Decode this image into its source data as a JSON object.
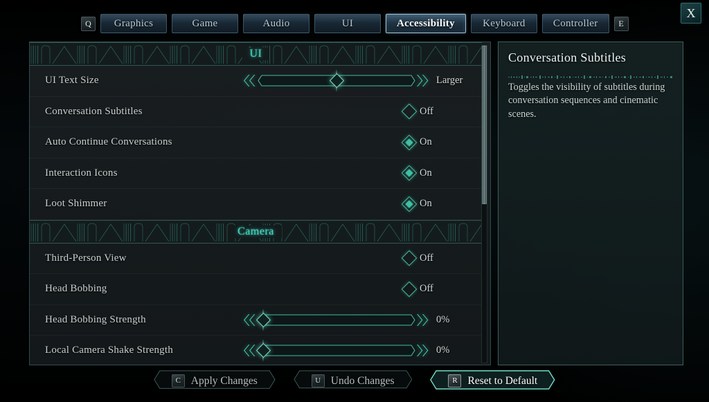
{
  "window": {
    "close_label": "X",
    "prev_tab_key": "Q",
    "next_tab_key": "E"
  },
  "tabs": [
    {
      "label": "Graphics",
      "active": false
    },
    {
      "label": "Game",
      "active": false
    },
    {
      "label": "Audio",
      "active": false
    },
    {
      "label": "UI",
      "active": false
    },
    {
      "label": "Accessibility",
      "active": true
    },
    {
      "label": "Keyboard",
      "active": false
    },
    {
      "label": "Controller",
      "active": false
    }
  ],
  "settings": {
    "sections": [
      {
        "title": "UI",
        "rows": [
          {
            "label": "UI Text Size",
            "type": "slider",
            "value": "Larger",
            "percent": 50
          },
          {
            "label": "Conversation Subtitles",
            "type": "toggle",
            "value": "Off",
            "on": false
          },
          {
            "label": "Auto Continue Conversations",
            "type": "toggle",
            "value": "On",
            "on": true
          },
          {
            "label": "Interaction Icons",
            "type": "toggle",
            "value": "On",
            "on": true
          },
          {
            "label": "Loot Shimmer",
            "type": "toggle",
            "value": "On",
            "on": true
          }
        ]
      },
      {
        "title": "Camera",
        "rows": [
          {
            "label": "Third-Person View",
            "type": "toggle",
            "value": "Off",
            "on": false
          },
          {
            "label": "Head Bobbing",
            "type": "toggle",
            "value": "Off",
            "on": false
          },
          {
            "label": "Head Bobbing Strength",
            "type": "slider",
            "value": "0%",
            "percent": 0
          },
          {
            "label": "Local Camera Shake Strength",
            "type": "slider",
            "value": "0%",
            "percent": 0
          }
        ]
      }
    ]
  },
  "scrollbar": {
    "thumb_top_percent": 0,
    "thumb_height_percent": 50
  },
  "info": {
    "title": "Conversation Subtitles",
    "body": "Toggles the visibility of subtitles during conversation sequences and cinematic scenes."
  },
  "actions": [
    {
      "key": "C",
      "label": "Apply Changes",
      "active": false
    },
    {
      "key": "U",
      "label": "Undo Changes",
      "active": false
    },
    {
      "key": "R",
      "label": "Reset to Default",
      "active": true
    }
  ],
  "colors": {
    "accent_teal": "#45d5c0",
    "toggle_teal": "#47b79d",
    "panel_border": "#4a7674",
    "tab_active_border": "#9fc0d6",
    "background": "#010203",
    "text_primary": "#c8cfcd",
    "text_bright": "#ffffff"
  }
}
